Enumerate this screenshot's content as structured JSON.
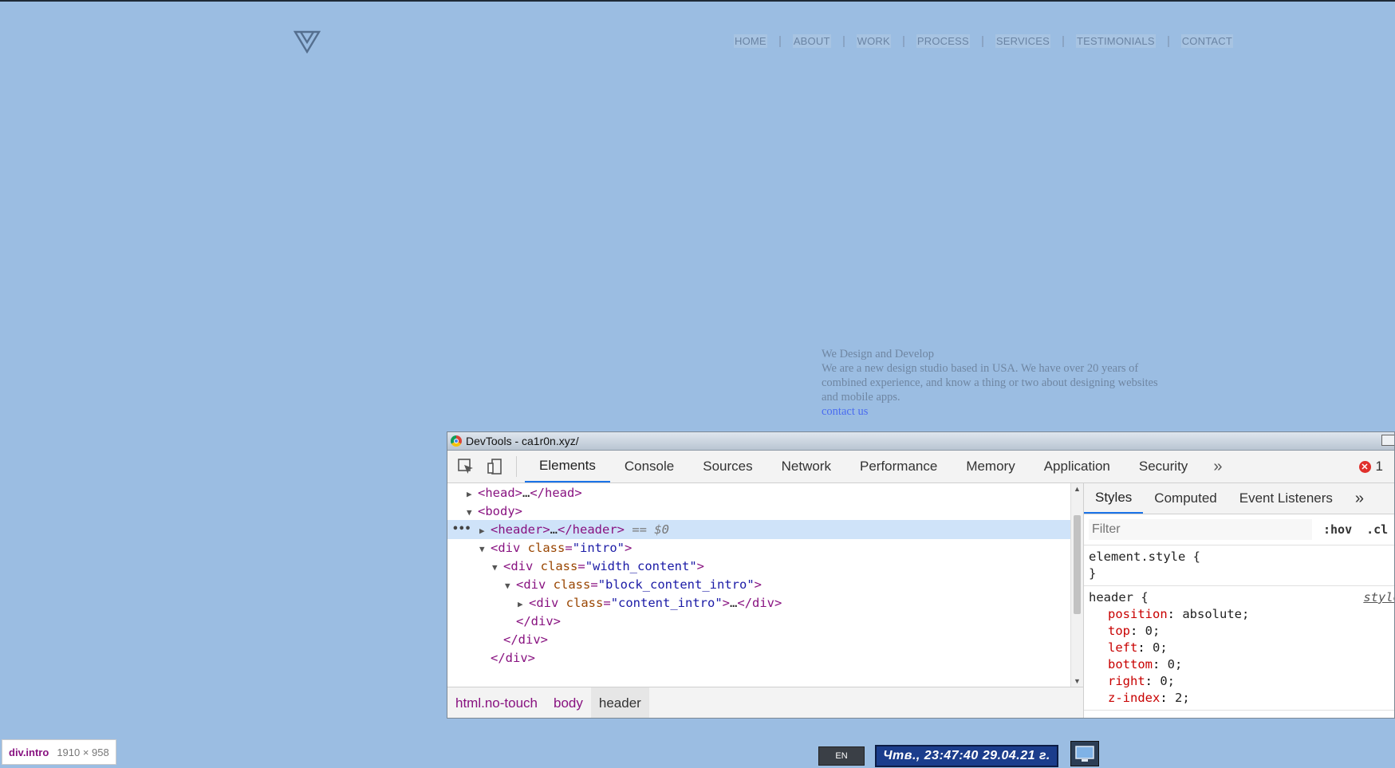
{
  "page": {
    "nav": [
      "HOME",
      "ABOUT",
      "WORK",
      "PROCESS",
      "SERVICES",
      "TESTIMONIALS",
      "CONTACT"
    ],
    "intro": {
      "heading": "We Design and Develop",
      "line1": "We are a new design studio based in USA. We have over 20 years of",
      "line2": "combined experience, and know a thing or two about designing websites",
      "line3": "and mobile apps.",
      "link": "contact us"
    }
  },
  "devtools": {
    "title": "DevTools - ca1r0n.xyz/",
    "tabs": [
      "Elements",
      "Console",
      "Sources",
      "Network",
      "Performance",
      "Memory",
      "Application",
      "Security"
    ],
    "more": "»",
    "error_count": "1",
    "dom": {
      "head_open": "<head>",
      "head_ellipsis": "…",
      "head_close": "</head>",
      "body_open": "<body>",
      "header_open": "<header>",
      "header_ellipsis": "…",
      "header_close": "</header>",
      "header_ref": "== $0",
      "div_open": "<div",
      "class_attr": "class",
      "intro_val": "\"intro\"",
      "width_content_val": "\"width_content\"",
      "block_content_intro_val": "\"block_content_intro\"",
      "content_intro_val": "\"content_intro\"",
      "gt": ">",
      "eq": "=",
      "ellipsis": "…",
      "div_close": "</div>",
      "dots": "•••"
    },
    "breadcrumbs": [
      "html.no-touch",
      "body",
      "header"
    ],
    "styles": {
      "tabs": [
        "Styles",
        "Computed",
        "Event Listeners"
      ],
      "more": "»",
      "filter_placeholder": "Filter",
      "hov": ":hov",
      "cls": ".cl",
      "element_style": "element.style {",
      "close_brace": "}",
      "header_selector": "header {",
      "source": "style",
      "props": [
        {
          "name": "position",
          "value": "absolute;"
        },
        {
          "name": "top",
          "value": "0;"
        },
        {
          "name": "left",
          "value": "0;"
        },
        {
          "name": "bottom",
          "value": "0;"
        },
        {
          "name": "right",
          "value": "0;"
        },
        {
          "name": "z-index",
          "value": "2;"
        }
      ]
    }
  },
  "tooltip": {
    "name": "div.intro",
    "size": "1910 × 958"
  },
  "taskbar": {
    "lang": "EN",
    "clock": "Чтв., 23:47:40 29.04.21 г."
  }
}
